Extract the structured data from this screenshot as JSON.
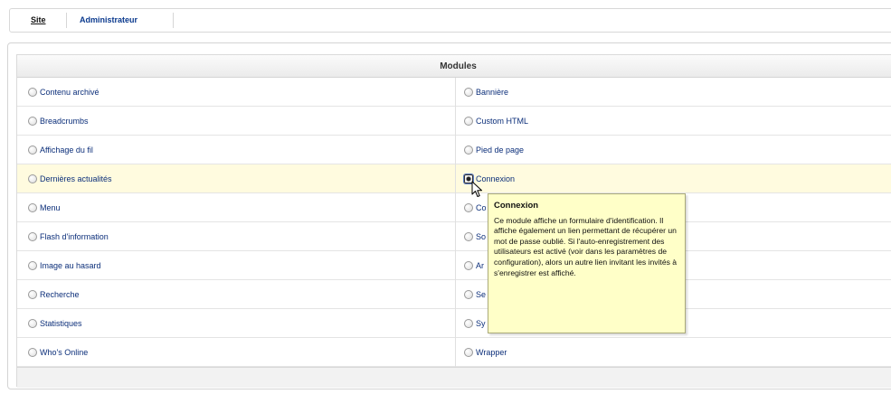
{
  "tabs": [
    {
      "label": "Site"
    },
    {
      "label": "Administrateur"
    }
  ],
  "modules": {
    "title": "Modules",
    "left": [
      "Contenu archivé",
      "Breadcrumbs",
      "Affichage du fil",
      "Dernières actualités",
      "Menu",
      "Flash d'information",
      "Image au hasard",
      "Recherche",
      "Statistiques",
      "Who's Online"
    ],
    "right": [
      "Bannière",
      "Custom HTML",
      "Pied de page",
      "Connexion",
      "Co",
      "So",
      "Ar",
      "Se",
      "Sy",
      "Wrapper"
    ],
    "selected": "Connexion"
  },
  "tooltip": {
    "title": "Connexion",
    "body": "Ce module affiche un formulaire d'identification. Il affiche également un lien permettant de récupérer un mot de passe oublié. Si l'auto-enregistrement des utilisateurs est activé (voir dans les paramètres de configuration), alors un autre lien invitant les invités à s'enregistrer est affiché."
  }
}
